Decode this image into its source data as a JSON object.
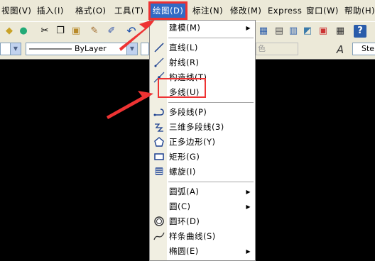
{
  "menubar": {
    "items": [
      {
        "label": "视图(V)"
      },
      {
        "label": "插入(I)"
      },
      {
        "label": "格式(O)"
      },
      {
        "label": "工具(T)"
      },
      {
        "label": "绘图(D)"
      },
      {
        "label": "标注(N)"
      },
      {
        "label": "修改(M)"
      },
      {
        "label": "Express"
      },
      {
        "label": "窗口(W)"
      },
      {
        "label": "帮助(H)"
      }
    ]
  },
  "toolbar": {
    "linetype_value": "ByLayer",
    "color_value": "色",
    "style_value": "Ste"
  },
  "draw_menu": {
    "items": [
      {
        "label": "建模(M)",
        "icon": "none",
        "submenu": true
      },
      {
        "label": "直线(L)",
        "icon": "line-icon"
      },
      {
        "label": "射线(R)",
        "icon": "ray-icon"
      },
      {
        "label": "构造线(T)",
        "icon": "construction-line-icon"
      },
      {
        "label": "多线(U)",
        "icon": "none"
      },
      {
        "label": "多段线(P)",
        "icon": "polyline-icon"
      },
      {
        "label": "三维多段线(3)",
        "icon": "3d-polyline-icon"
      },
      {
        "label": "正多边形(Y)",
        "icon": "polygon-icon"
      },
      {
        "label": "矩形(G)",
        "icon": "rectangle-icon"
      },
      {
        "label": "螺旋(I)",
        "icon": "helix-icon"
      },
      {
        "label": "圆弧(A)",
        "icon": "none",
        "submenu": true
      },
      {
        "label": "圆(C)",
        "icon": "none",
        "submenu": true
      },
      {
        "label": "圆环(D)",
        "icon": "donut-icon"
      },
      {
        "label": "样条曲线(S)",
        "icon": "spline-icon"
      },
      {
        "label": "椭圆(E)",
        "icon": "none",
        "submenu": true
      }
    ]
  },
  "colors": {
    "highlight": "#316ac5",
    "annotation": "#e33333",
    "menubar_bg": "#ece9d8"
  }
}
